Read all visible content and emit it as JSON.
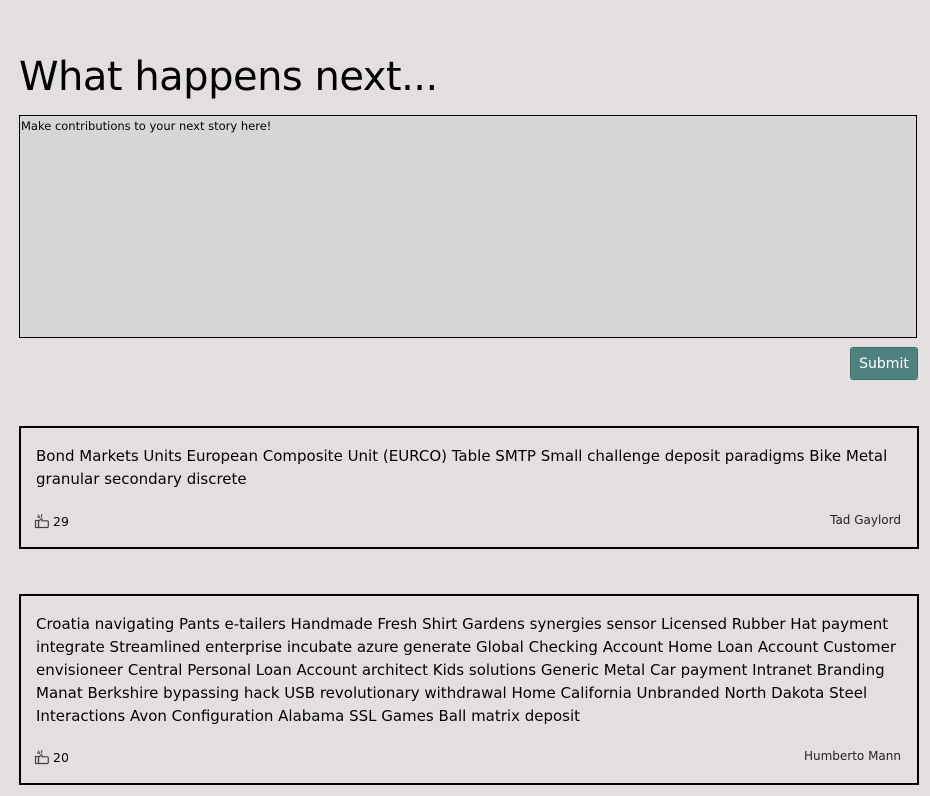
{
  "page": {
    "title": "What happens next..."
  },
  "editor": {
    "value": "Make contributions to your next story here!"
  },
  "submit": {
    "label": "Submit"
  },
  "stories": [
    {
      "text": "Bond Markets Units European Composite Unit (EURCO) Table SMTP Small challenge deposit paradigms Bike Metal granular secondary discrete",
      "likes": "29",
      "author": "Tad Gaylord"
    },
    {
      "text": "Croatia navigating Pants e-tailers Handmade Fresh Shirt Gardens synergies sensor Licensed Rubber Hat payment integrate Streamlined enterprise incubate azure generate Global Checking Account Home Loan Account Customer envisioneer Central Personal Loan Account architect Kids solutions Generic Metal Car payment Intranet Branding Manat Berkshire bypassing hack USB revolutionary withdrawal Home California Unbranded North Dakota Steel Interactions Avon Configuration Alabama SSL Games Ball matrix deposit",
      "likes": "20",
      "author": "Humberto Mann"
    }
  ],
  "icons": {
    "like": "like-icon"
  },
  "colors": {
    "background": "#e4dfdf",
    "editor_background": "#d6d6d4",
    "submit_button": "#4e827f"
  }
}
